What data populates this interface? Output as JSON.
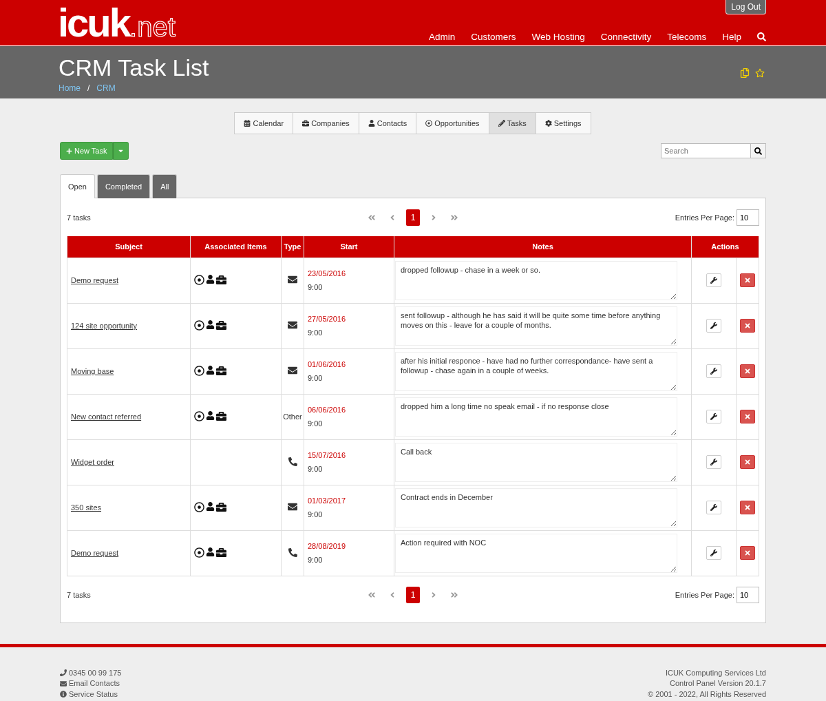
{
  "header": {
    "logo_main": "icuk",
    "logo_suffix": ".net",
    "logout": "Log Out",
    "nav": [
      "Admin",
      "Customers",
      "Web Hosting",
      "Connectivity",
      "Telecoms",
      "Help"
    ]
  },
  "title_bar": {
    "title": "CRM Task List",
    "breadcrumbs": [
      "Home",
      "CRM"
    ],
    "separator": "/"
  },
  "crm_tabs": [
    {
      "label": "Calendar",
      "selected": false
    },
    {
      "label": "Companies",
      "selected": false
    },
    {
      "label": "Contacts",
      "selected": false
    },
    {
      "label": "Opportunities",
      "selected": false
    },
    {
      "label": "Tasks",
      "selected": true
    },
    {
      "label": "Settings",
      "selected": false
    }
  ],
  "new_task": "New Task",
  "search": {
    "placeholder": "Search"
  },
  "status_tabs": [
    {
      "label": "Open",
      "selected": true
    },
    {
      "label": "Completed",
      "selected": false
    },
    {
      "label": "All",
      "selected": false
    }
  ],
  "pagers": [
    {
      "summary": "7 tasks",
      "pages": [
        {
          "label": "1",
          "selected": true
        }
      ],
      "entries_label": "Entries Per Page:",
      "entries_value": "10"
    },
    {
      "summary": "7 tasks",
      "pages": [
        {
          "label": "1",
          "selected": true
        }
      ],
      "entries_label": "Entries Per Page:",
      "entries_value": "10"
    }
  ],
  "table": {
    "columns": [
      "Subject",
      "Associated Items",
      "Type",
      "Start",
      "Notes",
      "Actions"
    ],
    "rows": [
      {
        "subject": "Demo request",
        "associated": true,
        "type": {
          "kind": "email"
        },
        "date": "23/05/2016",
        "time": "9:00",
        "notes": "dropped followup - chase in a week or so."
      },
      {
        "subject": "124 site opportunity",
        "associated": true,
        "type": {
          "kind": "email"
        },
        "date": "27/05/2016",
        "time": "9:00",
        "notes": "sent followup - although he has said it will be quite some time before anything moves on this - leave for a couple of months."
      },
      {
        "subject": "Moving base",
        "associated": true,
        "type": {
          "kind": "email"
        },
        "date": "01/06/2016",
        "time": "9:00",
        "notes": "after his initial responce - have had no further correspondance- have sent a followup - chase again in a couple of weeks."
      },
      {
        "subject": "New contact referred",
        "associated": true,
        "type": {
          "kind": "text",
          "label": "Other"
        },
        "date": "06/06/2016",
        "time": "9:00",
        "notes": "dropped him a long time no speak email - if no response close"
      },
      {
        "subject": "Widget order",
        "associated": false,
        "type": {
          "kind": "phone"
        },
        "date": "15/07/2016",
        "time": "9:00",
        "notes": "Call back"
      },
      {
        "subject": "350 sites",
        "associated": true,
        "type": {
          "kind": "email"
        },
        "date": "01/03/2017",
        "time": "9:00",
        "notes": "Contract ends in December"
      },
      {
        "subject": "Demo request",
        "associated": true,
        "type": {
          "kind": "phone"
        },
        "date": "28/08/2019",
        "time": "9:00",
        "notes": "Action required with NOC"
      }
    ]
  },
  "footer": {
    "left": [
      "0345 00 99 175",
      "Email Contacts",
      "Service Status"
    ],
    "right": [
      "ICUK Computing Services Ltd",
      "Control Panel Version 20.1.7",
      "© 2001 - 2022, All Rights Reserved"
    ]
  }
}
